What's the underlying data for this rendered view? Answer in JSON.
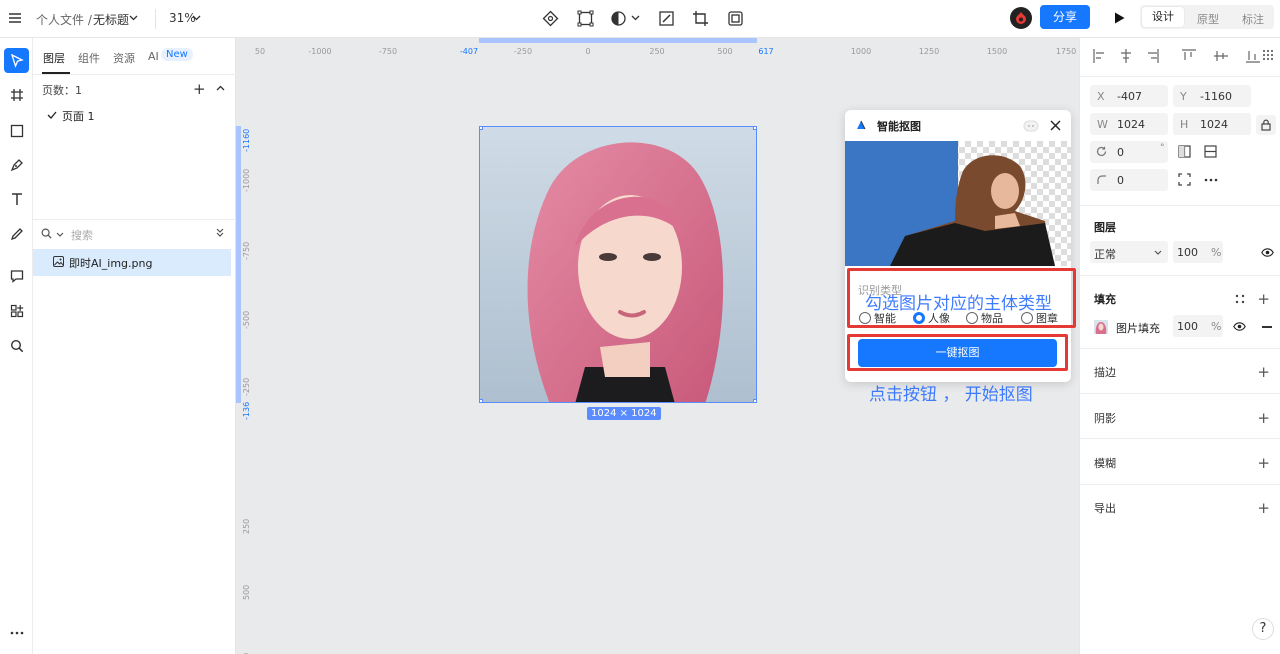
{
  "topbar": {
    "breadcrumb_parent": "个人文件 /",
    "file_name": "无标题",
    "zoom": "31%",
    "share_label": "分享",
    "mode_tabs": [
      "设计",
      "原型",
      "标注"
    ]
  },
  "layer_panel": {
    "tabs": [
      "图层",
      "组件",
      "资源",
      "AI"
    ],
    "new_badge": "New",
    "pages_label": "页数：1",
    "page_item": "页面 1",
    "search_placeholder": "搜索",
    "layer_item": "即时AI_img.png"
  },
  "rulers": {
    "x_ticks": [
      "50",
      "-1000",
      "-750",
      "-407",
      "-250",
      "0",
      "250",
      "500",
      "617",
      "1000",
      "1250",
      "1500",
      "1750"
    ],
    "y_ticks": [
      "-1160",
      "-1000",
      "-750",
      "-500",
      "-250",
      "-136",
      "250",
      "500",
      "750"
    ]
  },
  "canvas": {
    "size_badge": "1024 × 1024"
  },
  "dialog": {
    "title": "智能抠图",
    "type_label": "识别类型",
    "options": [
      "智能",
      "人像",
      "物品",
      "图章"
    ],
    "selected_option": "人像",
    "action_button": "一键抠图"
  },
  "annotations": {
    "select_hint": "勾选图片对应的主体类型",
    "click_hint": "点击按钮 ， 开始抠图",
    "annotation_color": "#e53935"
  },
  "properties": {
    "x": {
      "label": "X",
      "value": "-407"
    },
    "y": {
      "label": "Y",
      "value": "-1160"
    },
    "w": {
      "label": "W",
      "value": "1024"
    },
    "h": {
      "label": "H",
      "value": "1024"
    },
    "rotation": {
      "value": "0",
      "unit": "°"
    },
    "radius": {
      "value": "0"
    },
    "layer_section": "图层",
    "blend_mode": "正常",
    "layer_opacity": "100",
    "layer_opacity_unit": "%",
    "fill_section": "填充",
    "fill_name": "图片填充",
    "fill_opacity": "100",
    "fill_opacity_unit": "%",
    "stroke_section": "描边",
    "shadow_section": "阴影",
    "blur_section": "模糊",
    "export_section": "导出"
  },
  "help_label": "?",
  "colors": {
    "accent": "#1677ff",
    "canvas_bg": "#e9eaec"
  }
}
